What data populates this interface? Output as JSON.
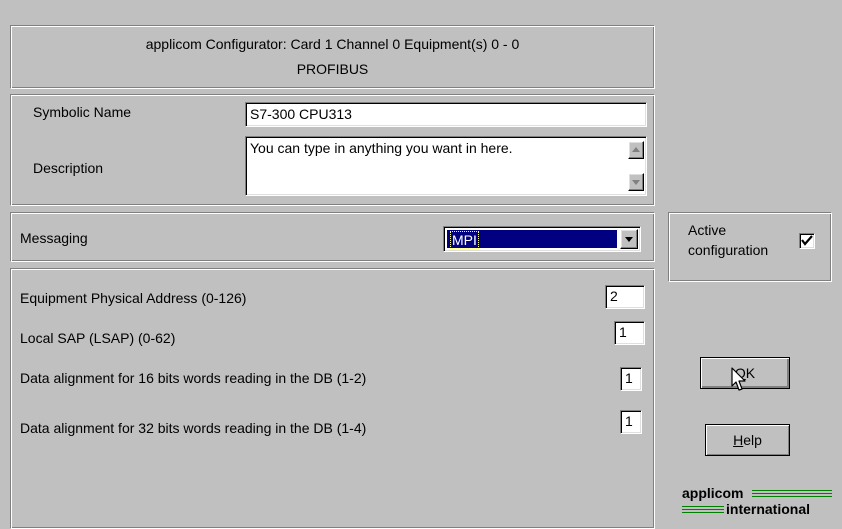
{
  "header": {
    "line1": "applicom Configurator: Card 1 Channel 0 Equipment(s) 0 - 0",
    "line2": "PROFIBUS"
  },
  "symbolic": {
    "label": "Symbolic Name",
    "value": "S7-300 CPU313"
  },
  "description": {
    "label": "Description",
    "value": "You can type in anything you want in here."
  },
  "messaging": {
    "label": "Messaging",
    "selected": "MPI"
  },
  "active": {
    "label_line1": "Active",
    "label_line2": "configuration",
    "checked": true
  },
  "params": [
    {
      "label": "Equipment Physical Address (0-126)",
      "value": "2"
    },
    {
      "label": "Local SAP (LSAP) (0-62)",
      "value": "1"
    },
    {
      "label": "Data alignment for 16 bits words reading in the DB (1-2)",
      "value": "1"
    },
    {
      "label": "Data alignment for 32 bits words reading in the DB (1-4)",
      "value": "1"
    }
  ],
  "buttons": {
    "ok_mnemonic": "O",
    "ok_rest": "K",
    "help_mnemonic": "H",
    "help_rest": "elp"
  },
  "logo": {
    "line1": "applicom",
    "line2": "international"
  },
  "colors": {
    "face": "#c0c0c0",
    "selection": "#000080"
  }
}
